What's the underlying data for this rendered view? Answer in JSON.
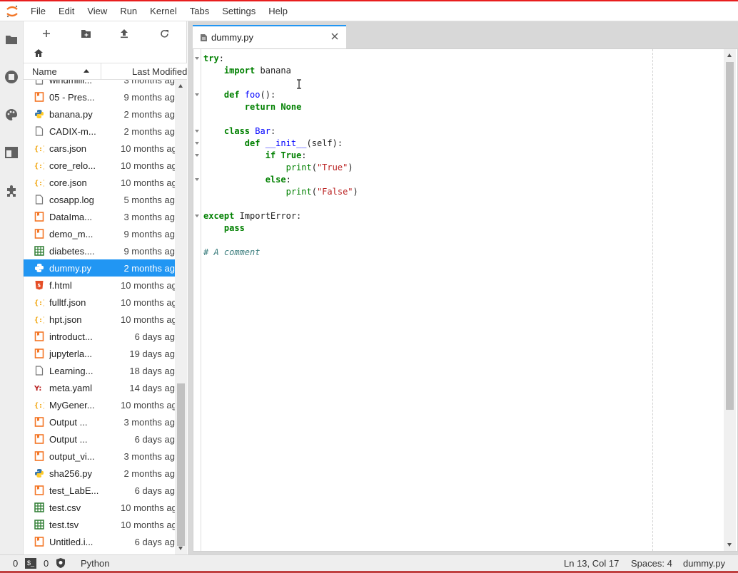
{
  "menubar": {
    "items": [
      "File",
      "Edit",
      "View",
      "Run",
      "Kernel",
      "Tabs",
      "Settings",
      "Help"
    ]
  },
  "activitybar": {
    "icons": [
      "folder-icon",
      "running-icon",
      "palette-icon",
      "tabs-icon",
      "extension-icon"
    ]
  },
  "filebrowser": {
    "toolbar": [
      "new-launcher-icon",
      "new-folder-icon",
      "upload-icon",
      "refresh-icon"
    ],
    "header": {
      "name": "Name",
      "modified": "Last Modified"
    },
    "files": [
      {
        "name": "windmilli...",
        "date": "3 months ag",
        "type": "generic"
      },
      {
        "name": "05 - Pres...",
        "date": "9 months ag",
        "type": "notebook"
      },
      {
        "name": "banana.py",
        "date": "2 months ag",
        "type": "python"
      },
      {
        "name": "CADIX-m...",
        "date": "2 months ag",
        "type": "generic"
      },
      {
        "name": "cars.json",
        "date": "10 months ag",
        "type": "json"
      },
      {
        "name": "core_relo...",
        "date": "10 months ag",
        "type": "json"
      },
      {
        "name": "core.json",
        "date": "10 months ag",
        "type": "json"
      },
      {
        "name": "cosapp.log",
        "date": "5 months ag",
        "type": "generic"
      },
      {
        "name": "DataIma...",
        "date": "3 months ag",
        "type": "notebook"
      },
      {
        "name": "demo_m...",
        "date": "9 months ag",
        "type": "notebook"
      },
      {
        "name": "diabetes....",
        "date": "9 months ag",
        "type": "table"
      },
      {
        "name": "dummy.py",
        "date": "2 months ag",
        "type": "python",
        "selected": true
      },
      {
        "name": "f.html",
        "date": "10 months ag",
        "type": "html"
      },
      {
        "name": "fulltf.json",
        "date": "10 months ag",
        "type": "json"
      },
      {
        "name": "hpt.json",
        "date": "10 months ag",
        "type": "json"
      },
      {
        "name": "introduct...",
        "date": "6 days ag",
        "type": "notebook"
      },
      {
        "name": "jupyterla...",
        "date": "19 days ag",
        "type": "notebook"
      },
      {
        "name": "Learning...",
        "date": "18 days ag",
        "type": "generic"
      },
      {
        "name": "meta.yaml",
        "date": "14 days ag",
        "type": "yaml"
      },
      {
        "name": "MyGener...",
        "date": "10 months ag",
        "type": "json"
      },
      {
        "name": "Output ...",
        "date": "3 months ag",
        "type": "notebook"
      },
      {
        "name": "Output ...",
        "date": "6 days ag",
        "type": "notebook"
      },
      {
        "name": "output_vi...",
        "date": "3 months ag",
        "type": "notebook"
      },
      {
        "name": "sha256.py",
        "date": "2 months ag",
        "type": "python"
      },
      {
        "name": "test_LabE...",
        "date": "6 days ag",
        "type": "notebook"
      },
      {
        "name": "test.csv",
        "date": "10 months ag",
        "type": "table"
      },
      {
        "name": "test.tsv",
        "date": "10 months ag",
        "type": "table"
      },
      {
        "name": "Untitled.i...",
        "date": "6 days ag",
        "type": "notebook"
      }
    ]
  },
  "editor": {
    "tab_label": "dummy.py",
    "lines": [
      [
        [
          "kw",
          "try"
        ],
        [
          "nm",
          ":"
        ]
      ],
      [
        [
          "nm",
          "    "
        ],
        [
          "kw",
          "import"
        ],
        [
          "nm",
          " banana"
        ]
      ],
      [
        [
          "nm",
          ""
        ]
      ],
      [
        [
          "nm",
          "    "
        ],
        [
          "kw",
          "def"
        ],
        [
          "nm",
          " "
        ],
        [
          "fn",
          "foo"
        ],
        [
          "nm",
          "():"
        ]
      ],
      [
        [
          "nm",
          "        "
        ],
        [
          "kw",
          "return"
        ],
        [
          "nm",
          " "
        ],
        [
          "kw",
          "None"
        ]
      ],
      [
        [
          "nm",
          ""
        ]
      ],
      [
        [
          "nm",
          "    "
        ],
        [
          "kw",
          "class"
        ],
        [
          "nm",
          " "
        ],
        [
          "fn",
          "Bar"
        ],
        [
          "nm",
          ":"
        ]
      ],
      [
        [
          "nm",
          "        "
        ],
        [
          "kw",
          "def"
        ],
        [
          "nm",
          " "
        ],
        [
          "fn",
          "__init__"
        ],
        [
          "nm",
          "(self):"
        ]
      ],
      [
        [
          "nm",
          "            "
        ],
        [
          "kw",
          "if"
        ],
        [
          "nm",
          " "
        ],
        [
          "kw",
          "True"
        ],
        [
          "nm",
          ":"
        ]
      ],
      [
        [
          "nm",
          "                "
        ],
        [
          "bi",
          "print"
        ],
        [
          "nm",
          "("
        ],
        [
          "str",
          "\"True\""
        ],
        [
          "nm",
          ")"
        ]
      ],
      [
        [
          "nm",
          "            "
        ],
        [
          "kw",
          "else"
        ],
        [
          "nm",
          ":"
        ]
      ],
      [
        [
          "nm",
          "                "
        ],
        [
          "bi",
          "print"
        ],
        [
          "nm",
          "("
        ],
        [
          "str",
          "\"False\""
        ],
        [
          "nm",
          ")"
        ]
      ],
      [
        [
          "nm",
          ""
        ]
      ],
      [
        [
          "kw",
          "except"
        ],
        [
          "nm",
          " ImportError:"
        ]
      ],
      [
        [
          "nm",
          "    "
        ],
        [
          "kw",
          "pass"
        ]
      ],
      [
        [
          "nm",
          ""
        ]
      ],
      [
        [
          "cm",
          "# A comment"
        ]
      ]
    ],
    "fold_lines": [
      0,
      3,
      6,
      7,
      8,
      10,
      13
    ]
  },
  "statusbar": {
    "terminals": "0",
    "kernels": "0",
    "kernel_name": "Python",
    "position": "Ln 13, Col 17",
    "spaces": "Spaces: 4",
    "filename": "dummy.py"
  },
  "colors": {
    "accent": "#2196f3",
    "python_icon": "#3776ab",
    "notebook_icon": "#f37626",
    "json_icon": "#f0a000",
    "table_icon": "#2e7d32",
    "html_icon": "#e44d26",
    "yaml_icon": "#b71c1c"
  }
}
